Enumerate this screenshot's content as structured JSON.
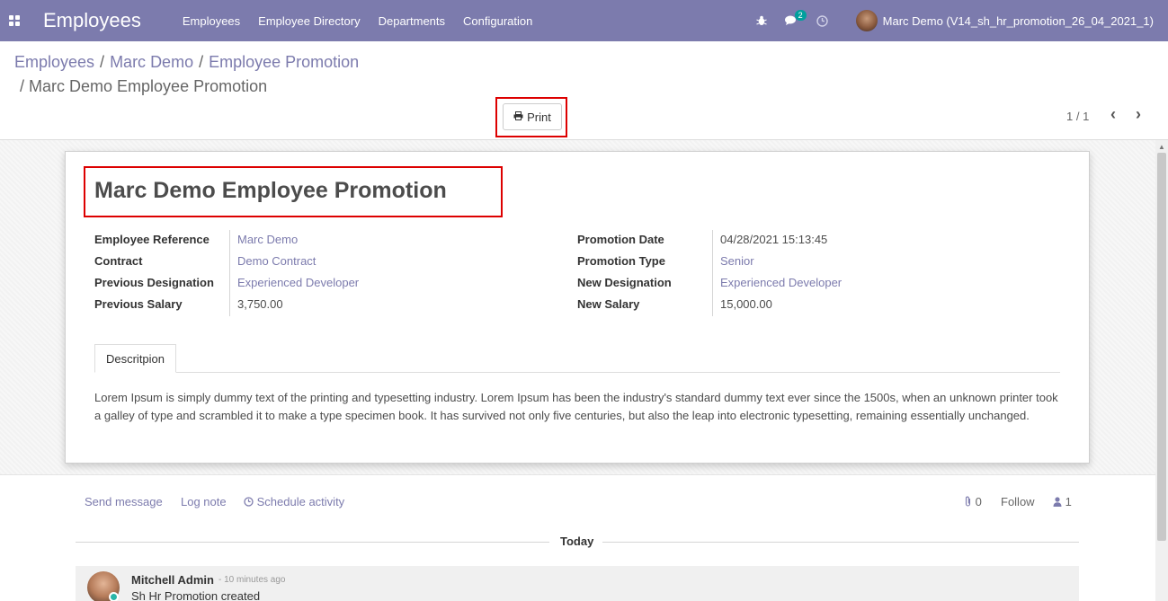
{
  "navbar": {
    "app_name": "Employees",
    "menu": [
      "Employees",
      "Employee Directory",
      "Departments",
      "Configuration"
    ],
    "messages_badge": "2",
    "user": "Marc Demo (V14_sh_hr_promotion_26_04_2021_1)",
    "color": "#7c7bad"
  },
  "breadcrumb": {
    "items": [
      "Employees",
      "Marc Demo",
      "Employee Promotion"
    ],
    "current": "Marc Demo Employee Promotion"
  },
  "toolbar": {
    "print_label": "Print",
    "pager": "1 / 1"
  },
  "form": {
    "title": "Marc Demo Employee Promotion",
    "left_fields": [
      {
        "label": "Employee Reference",
        "value": "Marc Demo"
      },
      {
        "label": "Contract",
        "value": "Demo Contract"
      },
      {
        "label": "Previous Designation",
        "value": "Experienced Developer"
      },
      {
        "label": "Previous Salary",
        "value": "3,750.00"
      }
    ],
    "right_fields": [
      {
        "label": "Promotion Date",
        "value": "04/28/2021 15:13:45"
      },
      {
        "label": "Promotion Type",
        "value": "Senior"
      },
      {
        "label": "New Designation",
        "value": "Experienced Developer"
      },
      {
        "label": "New Salary",
        "value": "15,000.00"
      }
    ],
    "tab_label": "Descritpion",
    "description": "Lorem Ipsum is simply dummy text of the printing and typesetting industry. Lorem Ipsum has been the industry's standard dummy text ever since the 1500s, when an unknown printer took a galley of type and scrambled it to make a type specimen book. It has survived not only five centuries, but also the leap into electronic typesetting, remaining essentially unchanged."
  },
  "chatter": {
    "send_message": "Send message",
    "log_note": "Log note",
    "schedule_activity": "Schedule activity",
    "attachments_count": "0",
    "follow": "Follow",
    "followers_count": "1",
    "today": "Today",
    "message": {
      "author": "Mitchell Admin",
      "time": "- 10 minutes ago",
      "body": "Sh Hr Promotion created"
    }
  }
}
